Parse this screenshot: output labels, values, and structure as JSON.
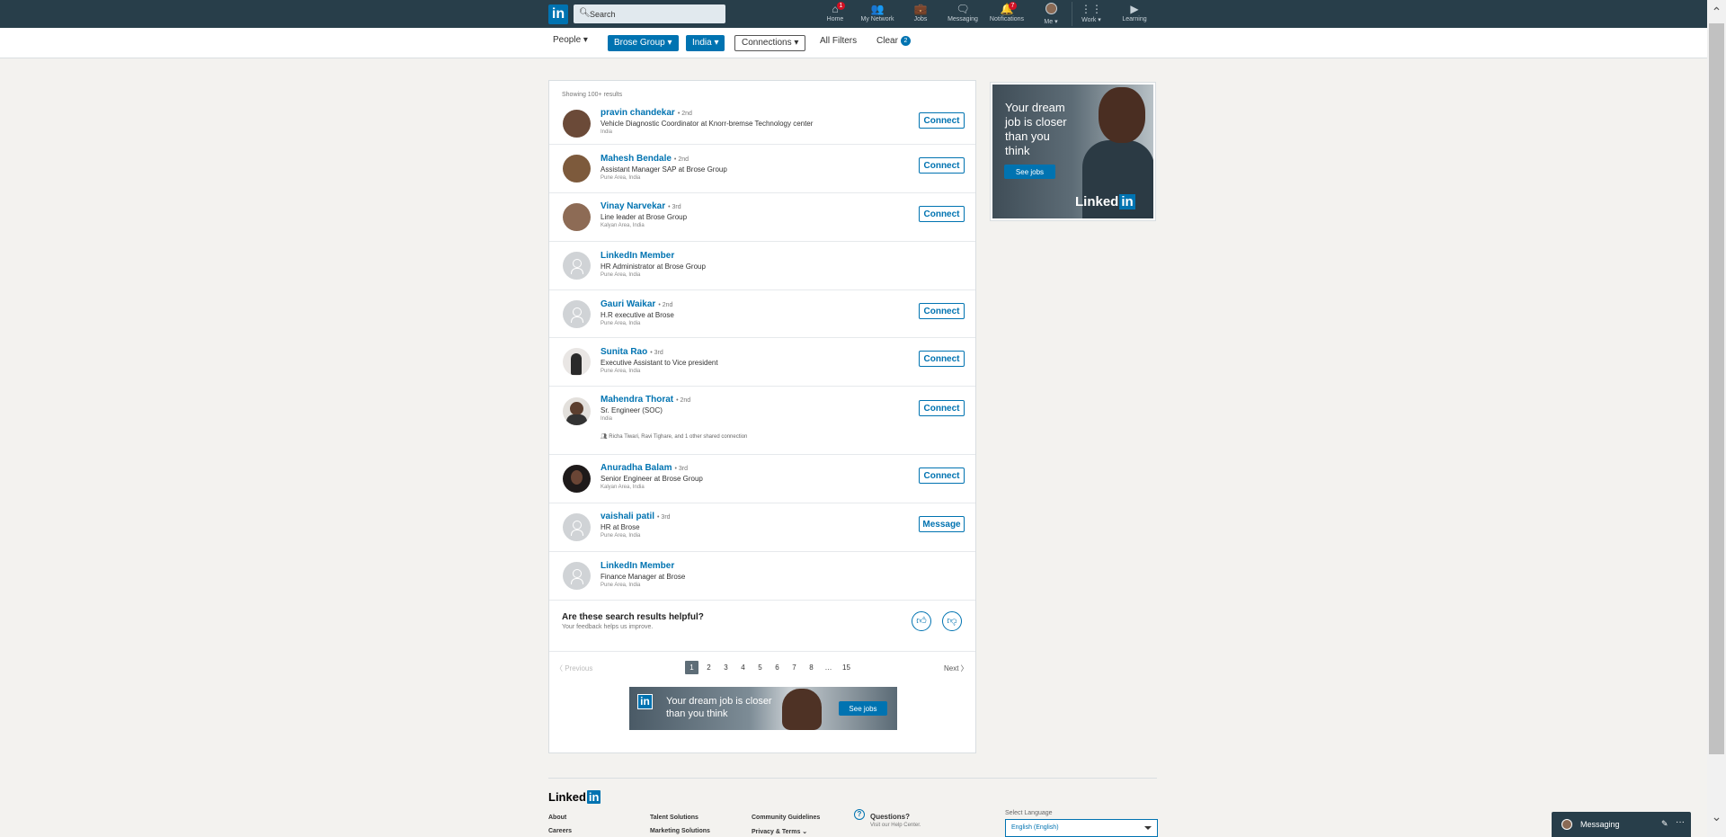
{
  "nav": {
    "search_placeholder": "Search",
    "logo_text": "in",
    "items": [
      {
        "label": "Home",
        "icon": "⌂",
        "badge": "1"
      },
      {
        "label": "My Network",
        "icon": "👥",
        "badge": ""
      },
      {
        "label": "Jobs",
        "icon": "💼",
        "badge": ""
      },
      {
        "label": "Messaging",
        "icon": "🗨",
        "badge": ""
      },
      {
        "label": "Notifications",
        "icon": "🔔",
        "badge": "7"
      },
      {
        "label": "Me ▾",
        "icon": "",
        "badge": ""
      },
      {
        "label": "Work ▾",
        "icon": "⋮⋮",
        "badge": ""
      },
      {
        "label": "Learning",
        "icon": "▶",
        "badge": ""
      }
    ]
  },
  "filters": {
    "people": "People ▾",
    "company": "Brose Group ▾",
    "location": "India ▾",
    "connections": "Connections ▾",
    "all_filters": "All Filters",
    "clear": "Clear",
    "clear_count": "2"
  },
  "results": {
    "count": "Showing 100+ results",
    "people": [
      {
        "name": "pravin chandekar",
        "degree": "• 2nd",
        "title": "Vehicle Diagnostic Coordinator at Knorr-bremse Technology center",
        "location": "India",
        "action": "Connect"
      },
      {
        "name": "Mahesh Bendale",
        "degree": "• 2nd",
        "title": "Assistant Manager SAP at Brose Group",
        "location": "Pune Area, India",
        "action": "Connect"
      },
      {
        "name": "Vinay Narvekar",
        "degree": "• 3rd",
        "title": "Line leader at Brose Group",
        "location": "Kalyan Area, India",
        "action": "Connect"
      },
      {
        "name": "LinkedIn Member",
        "degree": "",
        "title": "HR Administrator at Brose Group",
        "location": "Pune Area, India",
        "action": ""
      },
      {
        "name": "Gauri Waikar",
        "degree": "• 2nd",
        "title": "H.R executive at Brose",
        "location": "Pune Area, India",
        "action": "Connect"
      },
      {
        "name": "Sunita Rao",
        "degree": "• 3rd",
        "title": "Executive Assistant to Vice president",
        "location": "Pune Area, India",
        "action": "Connect"
      },
      {
        "name": "Mahendra Thorat",
        "degree": "• 2nd",
        "title": "Sr. Engineer (SOC)",
        "location": "India",
        "action": "Connect",
        "shared": "Richa Tiwari, Ravi Tighare, and 1 other shared connection"
      },
      {
        "name": "Anuradha Balam",
        "degree": "• 3rd",
        "title": "Senior Engineer at Brose Group",
        "location": "Kalyan Area, India",
        "action": "Connect"
      },
      {
        "name": "vaishali patil",
        "degree": "• 3rd",
        "title": "HR at Brose",
        "location": "Pune Area, India",
        "action": "Message"
      },
      {
        "name": "LinkedIn Member",
        "degree": "",
        "title": "Finance Manager at Brose",
        "location": "Pune Area, India",
        "action": ""
      }
    ],
    "feedback_question": "Are these search results helpful?",
    "feedback_sub": "Your feedback helps us improve.",
    "pager": {
      "previous": "〈 Previous",
      "next": "Next 〉",
      "pages": [
        "1",
        "2",
        "3",
        "4",
        "5",
        "6",
        "7",
        "8",
        "…",
        "15"
      ],
      "current": "1"
    },
    "bottom_ad": {
      "logo": "in",
      "text": "Your dream job is closer than you think",
      "button": "See jobs"
    }
  },
  "side_ad": {
    "text": "Your dream job is closer than you think",
    "button": "See jobs",
    "logo_word": "Linked",
    "logo_in": "in"
  },
  "footer": {
    "logo_word": "Linked",
    "logo_in": "in",
    "links": [
      "About",
      "Careers",
      "Talent Solutions",
      "Marketing Solutions",
      "Community Guidelines",
      "Privacy & Terms ⌄"
    ],
    "questions": "Questions?",
    "questions_sub": "Visit our Help Center.",
    "language_label": "Select Language",
    "language_value": "English (English)"
  },
  "messaging": {
    "label": "Messaging",
    "compose_icon": "✎",
    "more_icon": "···"
  },
  "colors": {
    "brand": "#0073b1",
    "nav_bg": "#283e4a",
    "page_bg": "#f3f2ef"
  }
}
